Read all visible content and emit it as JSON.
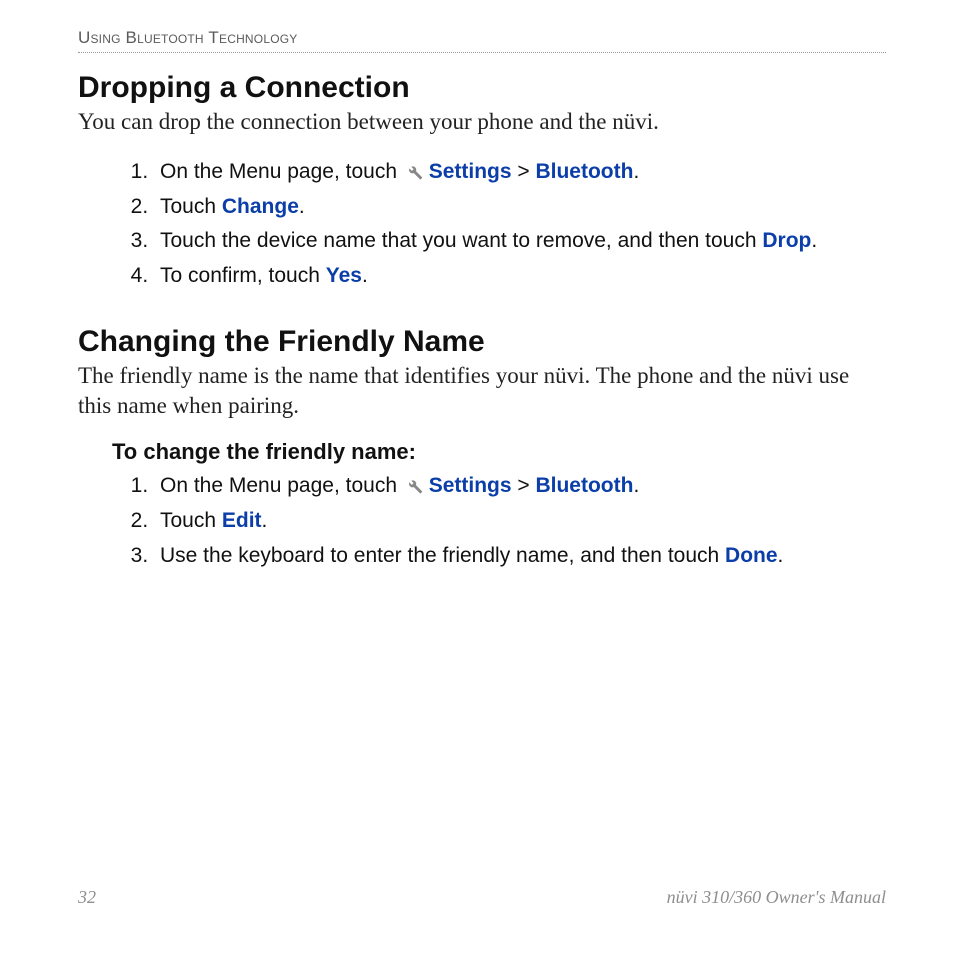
{
  "runningHead": "Using Bluetooth Technology",
  "section1": {
    "title": "Dropping a Connection",
    "lead": "You can drop the connection between your phone and the nüvi.",
    "steps": {
      "s1a": "On the Menu page, touch ",
      "s1_settings": "Settings",
      "s1_sep": " > ",
      "s1_bluetooth": "Bluetooth",
      "s1_end": ".",
      "s2a": "Touch ",
      "s2_change": "Change",
      "s2_end": ".",
      "s3a": "Touch the device name that you want to remove, and then touch ",
      "s3_drop": "Drop",
      "s3_end": ".",
      "s4a": "To confirm, touch ",
      "s4_yes": "Yes",
      "s4_end": "."
    }
  },
  "section2": {
    "title": "Changing the Friendly Name",
    "lead": "The friendly name is the name that identifies your nüvi. The phone and the nüvi use this name when pairing.",
    "subhead": "To change the friendly name:",
    "steps": {
      "s1a": "On the Menu page, touch ",
      "s1_settings": "Settings",
      "s1_sep": " > ",
      "s1_bluetooth": "Bluetooth",
      "s1_end": ".",
      "s2a": "Touch ",
      "s2_edit": "Edit",
      "s2_end": ".",
      "s3a": "Use the keyboard to enter the friendly name, and then touch ",
      "s3_done": "Done",
      "s3_end": "."
    }
  },
  "footer": {
    "pageNumber": "32",
    "manualTitle": "nüvi 310/360 Owner's Manual"
  }
}
